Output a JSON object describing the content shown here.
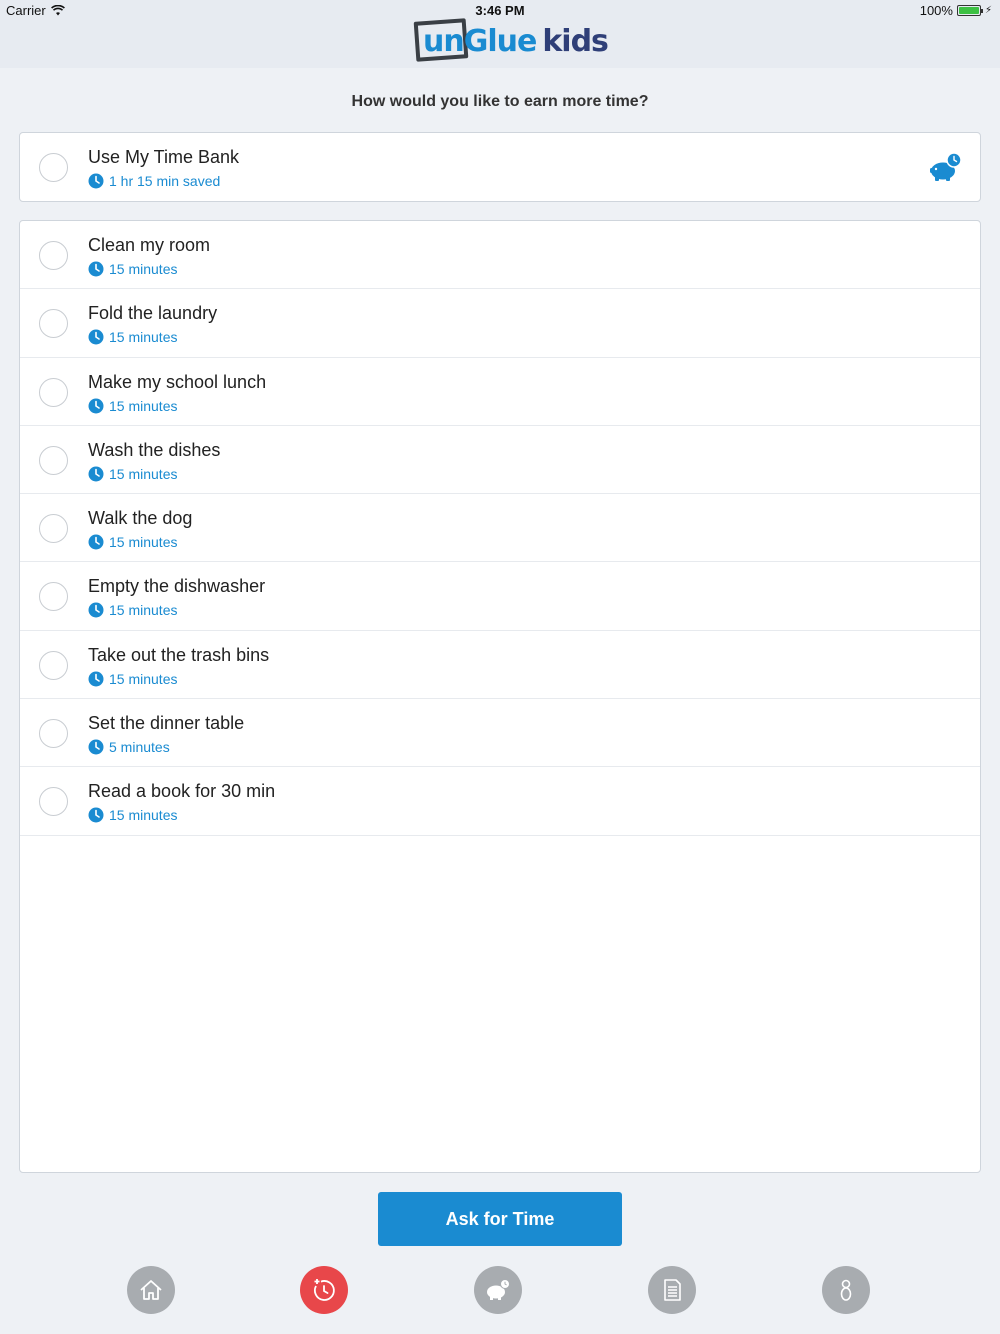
{
  "status_bar": {
    "carrier": "Carrier",
    "time": "3:46 PM",
    "battery": "100%",
    "battery_level": 1.0
  },
  "logo": {
    "un": "un",
    "glue": "Glue",
    "kids": "kids"
  },
  "question": "How would you like to earn more time?",
  "time_bank": {
    "title": "Use My Time Bank",
    "subtitle": "1 hr 15 min saved",
    "icon": "piggy-bank-icon"
  },
  "tasks": [
    {
      "title": "Clean my room",
      "duration": "15 minutes"
    },
    {
      "title": "Fold the laundry",
      "duration": "15 minutes"
    },
    {
      "title": "Make my school lunch",
      "duration": "15 minutes"
    },
    {
      "title": "Wash the dishes",
      "duration": "15 minutes"
    },
    {
      "title": "Walk the dog",
      "duration": "15 minutes"
    },
    {
      "title": "Empty the dishwasher",
      "duration": "15 minutes"
    },
    {
      "title": "Take out the trash bins",
      "duration": "15 minutes"
    },
    {
      "title": "Set the dinner table",
      "duration": "5 minutes"
    },
    {
      "title": "Read a book for 30 min",
      "duration": "15 minutes"
    }
  ],
  "ask_button": "Ask for Time",
  "nav": [
    {
      "name": "home",
      "icon": "home-icon",
      "active": false
    },
    {
      "name": "earn-time",
      "icon": "add-time-icon",
      "active": true
    },
    {
      "name": "time-bank",
      "icon": "piggy-bank-icon",
      "active": false
    },
    {
      "name": "reports",
      "icon": "document-icon",
      "active": false
    },
    {
      "name": "profile",
      "icon": "person-icon",
      "active": false
    }
  ],
  "colors": {
    "accent": "#1a8bd1",
    "active_nav": "#e8474a",
    "inactive_nav": "#a8acb0",
    "background": "#eef1f5"
  }
}
